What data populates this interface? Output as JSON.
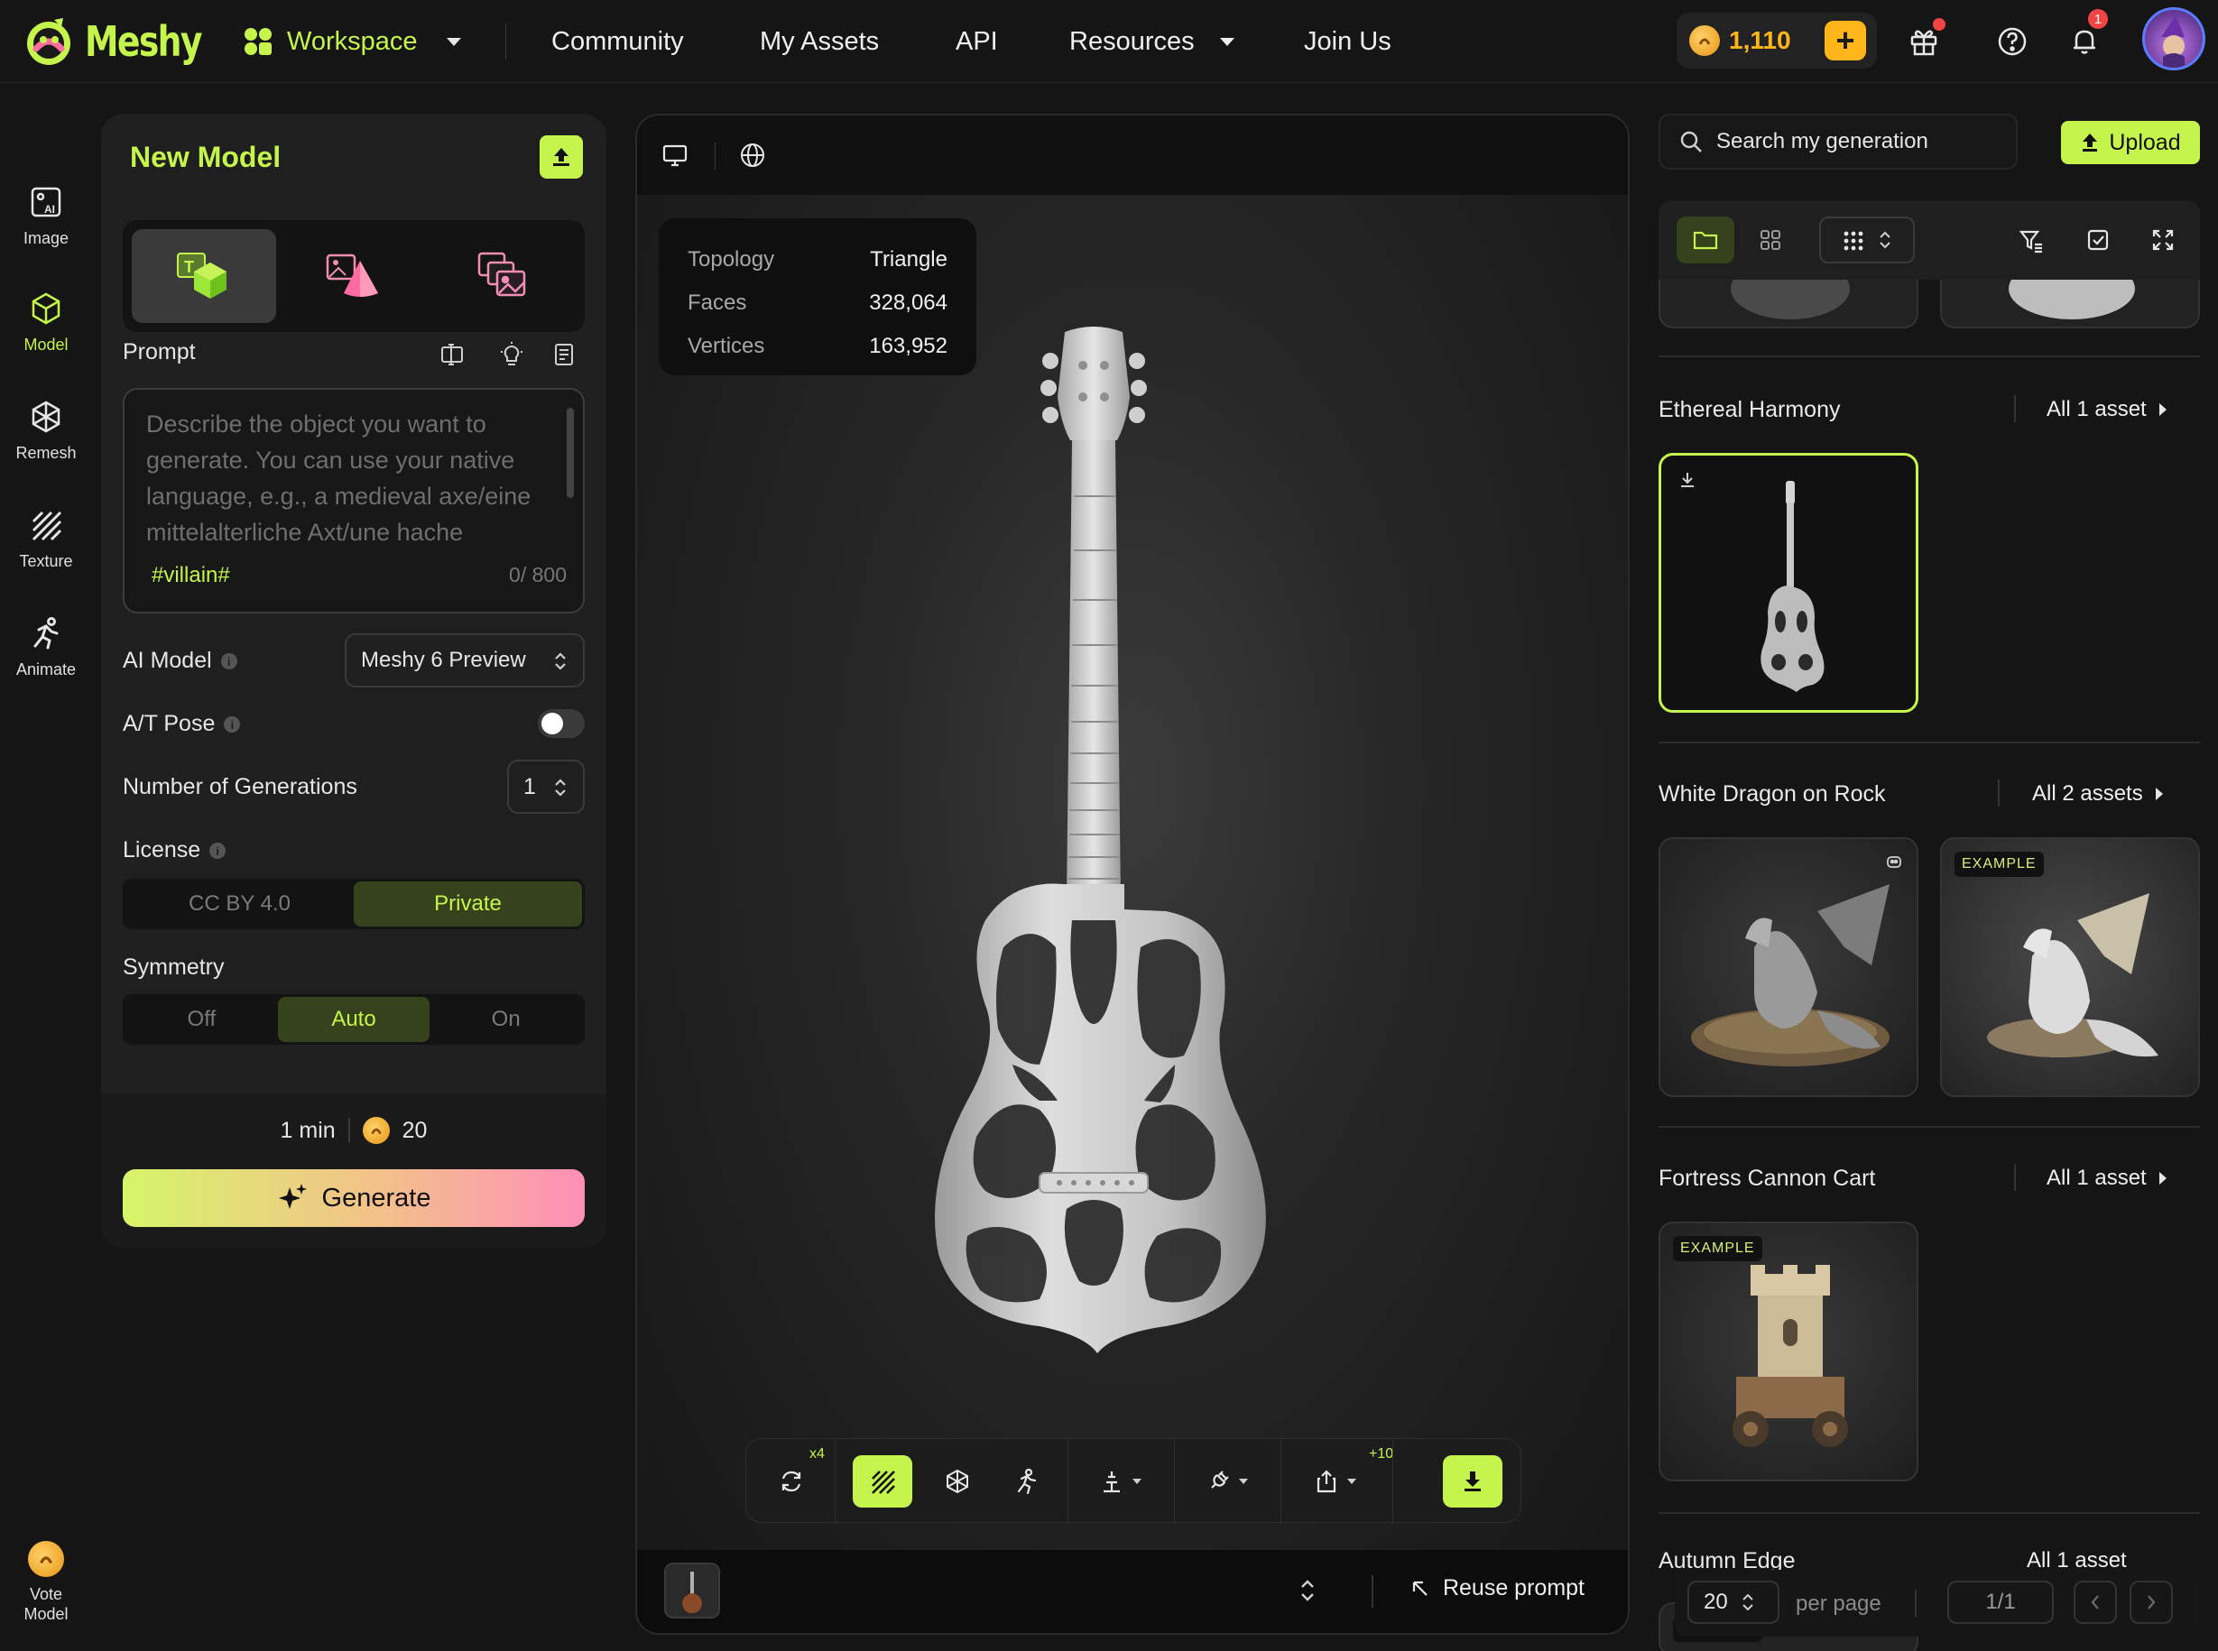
{
  "app": {
    "brand": "Meshy"
  },
  "nav": {
    "workspace": "Workspace",
    "community": "Community",
    "my_assets": "My Assets",
    "api": "API",
    "resources": "Resources",
    "join_us": "Join Us"
  },
  "account": {
    "credits": "1,110",
    "plus": "+",
    "notifications": "1"
  },
  "rail": {
    "image": "Image",
    "model": "Model",
    "remesh": "Remesh",
    "texture": "Texture",
    "animate": "Animate",
    "vote": "Vote Model"
  },
  "panel": {
    "title": "New Model",
    "prompt_label": "Prompt",
    "prompt_placeholder": "Describe the object you want to generate. You can use your native language, e.g., a medieval axe/eine mittelalterliche Axt/une hache",
    "prompt_tag": "#villain#",
    "prompt_count": "0/ 800",
    "ai_model_label": "AI Model",
    "ai_model_value": "Meshy 6 Preview",
    "pose_label": "A/T Pose",
    "pose_enabled": false,
    "generations_label": "Number of Generations",
    "generations_value": "1",
    "license_label": "License",
    "license_options": [
      "CC BY 4.0",
      "Private"
    ],
    "license_selected": "Private",
    "symmetry_label": "Symmetry",
    "symmetry_options": [
      "Off",
      "Auto",
      "On"
    ],
    "symmetry_selected": "Auto",
    "time_estimate": "1 min",
    "cost": "20",
    "generate_label": "Generate"
  },
  "viewer": {
    "stats": [
      {
        "key": "Topology",
        "value": "Triangle"
      },
      {
        "key": "Faces",
        "value": "328,064"
      },
      {
        "key": "Vertices",
        "value": "163,952"
      }
    ],
    "retry_count": "x4",
    "share_bonus": "+10",
    "reuse_prompt": "Reuse prompt"
  },
  "assets": {
    "search_placeholder": "Search my generation",
    "upload_label": "Upload",
    "groups": [
      {
        "title": "Ethereal Harmony",
        "all_label": "All 1 asset"
      },
      {
        "title": "White Dragon on Rock",
        "all_label": "All 2 assets",
        "badges": [
          "",
          "EXAMPLE"
        ]
      },
      {
        "title": "Fortress Cannon Cart",
        "all_label": "All 1 asset",
        "badges": [
          "EXAMPLE"
        ]
      },
      {
        "title": "Autumn Edge",
        "all_label": "All 1 asset"
      }
    ],
    "partial_badge": "EXAMPLE",
    "per_page_value": "20",
    "per_page_label": "per page",
    "page_value": "1/1"
  },
  "colors": {
    "accent": "#c5f54c",
    "coin": "#ffb61a",
    "alert": "#f04545"
  }
}
